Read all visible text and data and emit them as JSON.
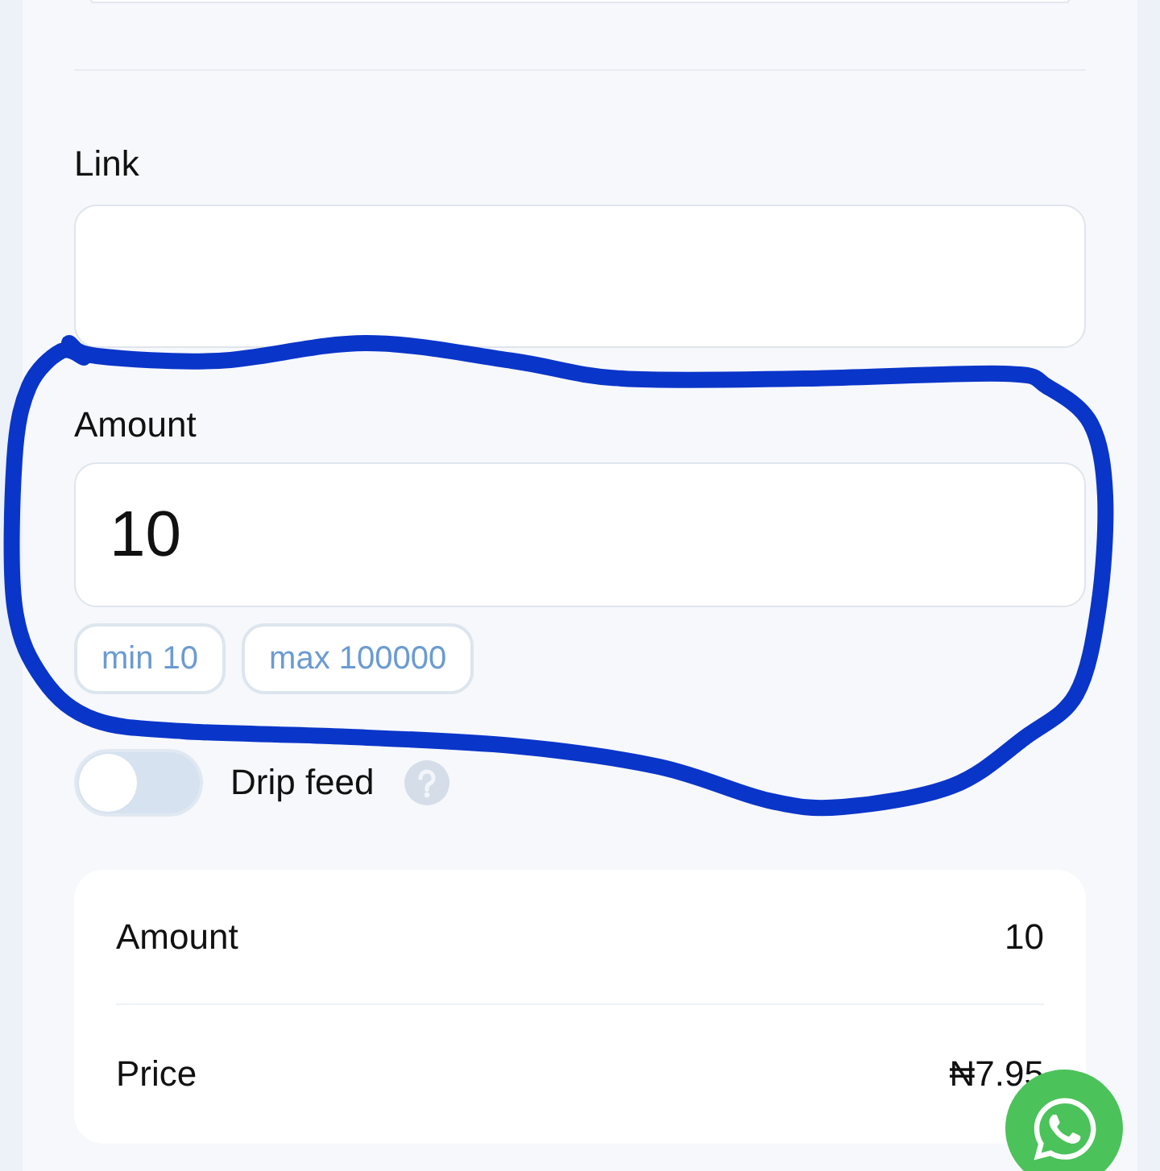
{
  "form": {
    "fields": [
      {
        "kind": "text",
        "label": "Link"
      },
      {
        "kind": "number",
        "label": "Amount",
        "value": "10",
        "chips": [
          "min 10",
          "max 100000"
        ]
      }
    ],
    "drip_feed": {
      "label": "Drip feed",
      "on": false
    }
  },
  "summary": {
    "rows": [
      {
        "label": "Amount",
        "value": "10"
      },
      {
        "label": "Price",
        "value": "₦7.95"
      }
    ]
  }
}
